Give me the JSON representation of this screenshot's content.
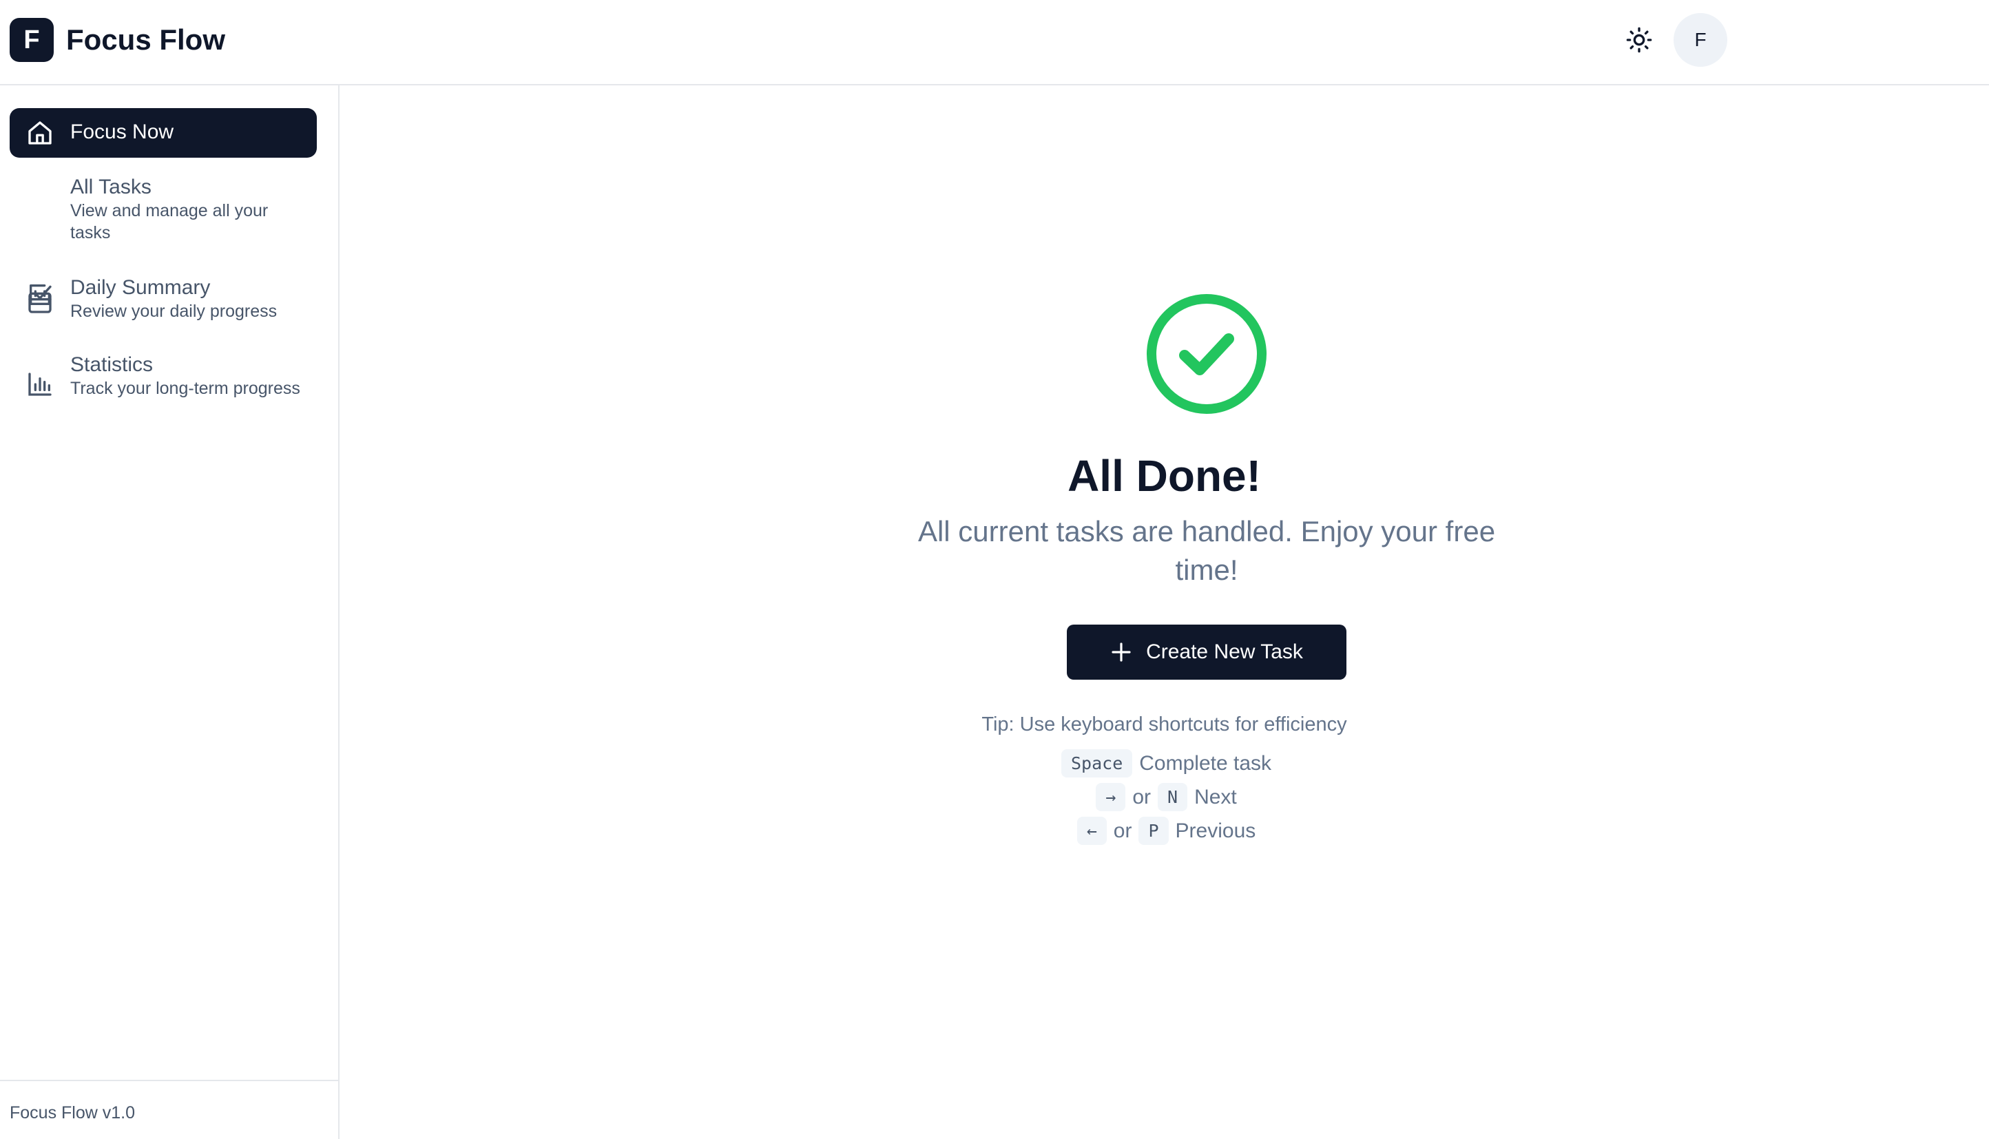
{
  "header": {
    "logo_letter": "F",
    "app_name": "Focus Flow",
    "avatar_initial": "F"
  },
  "sidebar": {
    "items": [
      {
        "title": "Focus Now",
        "desc": "",
        "icon": "home-icon",
        "active": true
      },
      {
        "title": "All Tasks",
        "desc": "View and manage all your tasks",
        "icon": "check-square-icon",
        "active": false
      },
      {
        "title": "Daily Summary",
        "desc": "Review your daily progress",
        "icon": "calendar-icon",
        "active": false
      },
      {
        "title": "Statistics",
        "desc": "Track your long-term progress",
        "icon": "bar-chart-icon",
        "active": false
      }
    ],
    "footer": "Focus Flow v1.0"
  },
  "main": {
    "status_icon": "check-circle-icon",
    "title": "All Done!",
    "subtitle": "All current tasks are handled. Enjoy your free time!",
    "create_button": "Create New Task",
    "tip": "Tip: Use keyboard shortcuts for efficiency",
    "shortcuts": [
      {
        "keys": [
          "Space"
        ],
        "separator": "",
        "label": "Complete task"
      },
      {
        "keys": [
          "→",
          "N"
        ],
        "separator": "or",
        "label": "Next"
      },
      {
        "keys": [
          "←",
          "P"
        ],
        "separator": "or",
        "label": "Previous"
      }
    ]
  },
  "colors": {
    "primary": "#0f172a",
    "success": "#22c55e",
    "muted_text": "#64748b",
    "border": "#e5e7eb"
  }
}
